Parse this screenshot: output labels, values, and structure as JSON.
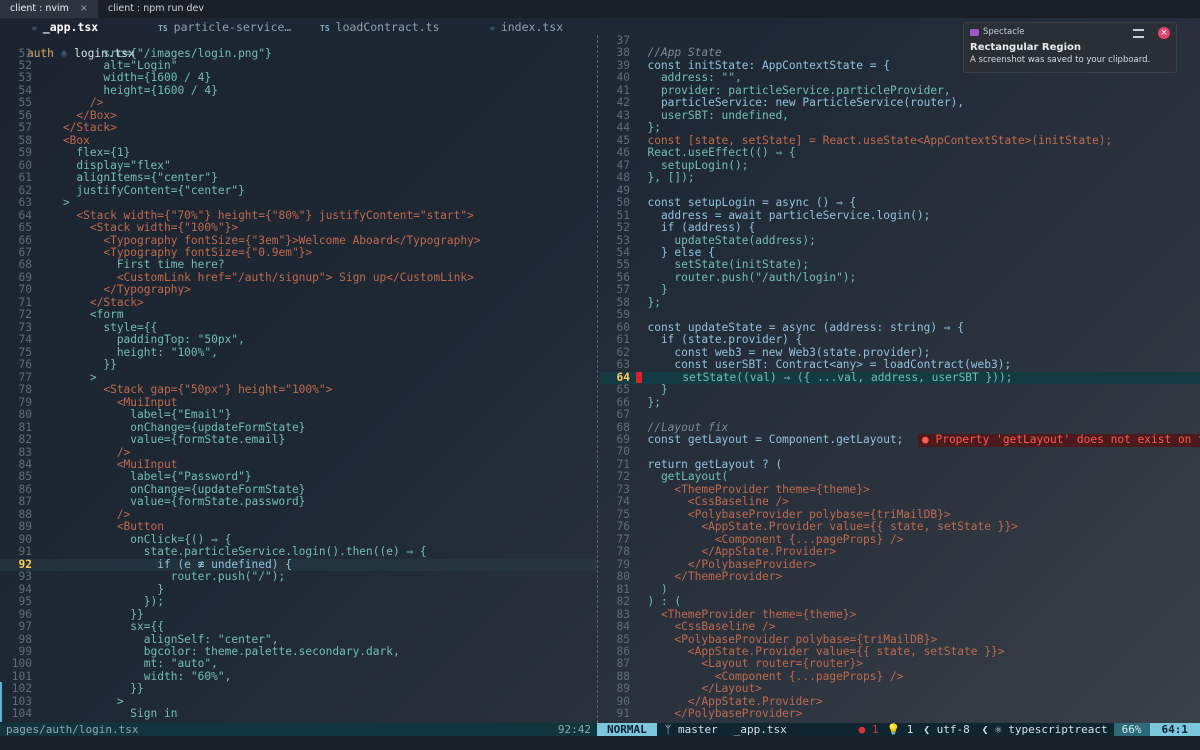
{
  "tmux": {
    "tabs": [
      {
        "label": "client : nvim",
        "active": true
      },
      {
        "label": "client : npm run dev",
        "active": false
      }
    ],
    "close_glyph": "×"
  },
  "buffers": [
    {
      "label": "_app.tsx",
      "active": true,
      "icon": "react-file-icon"
    },
    {
      "label": "particle-service…",
      "active": false,
      "icon": "typescript-file-icon",
      "icon_text": "TS"
    },
    {
      "label": "loadContract.ts",
      "active": false,
      "icon": "typescript-file-icon",
      "icon_text": "TS"
    },
    {
      "label": "index.tsx",
      "active": false,
      "icon": "react-file-icon"
    }
  ],
  "left_pane": {
    "path_prefix": "auth",
    "file_tab": "login.tsx",
    "lines": [
      {
        "n": "51",
        "t": "          src={\"/images/login.png\"}"
      },
      {
        "n": "52",
        "t": "          alt=\"Login\""
      },
      {
        "n": "53",
        "t": "          width={1600 / 4}"
      },
      {
        "n": "54",
        "t": "          height={1600 / 4}"
      },
      {
        "n": "55",
        "t": "        />"
      },
      {
        "n": "56",
        "t": "      </Box>"
      },
      {
        "n": "57",
        "t": "    </Stack>"
      },
      {
        "n": "58",
        "t": "    <Box"
      },
      {
        "n": "59",
        "t": "      flex={1}"
      },
      {
        "n": "60",
        "t": "      display=\"flex\""
      },
      {
        "n": "61",
        "t": "      alignItems={\"center\"}"
      },
      {
        "n": "62",
        "t": "      justifyContent={\"center\"}"
      },
      {
        "n": "63",
        "t": "    >"
      },
      {
        "n": "64",
        "t": "      <Stack width={\"70%\"} height={\"80%\"} justifyContent=\"start\">"
      },
      {
        "n": "65",
        "t": "        <Stack width={\"100%\"}>"
      },
      {
        "n": "66",
        "t": "          <Typography fontSize={\"3em\"}>Welcome Aboard</Typography>"
      },
      {
        "n": "67",
        "t": "          <Typography fontSize={\"0.9em\"}>"
      },
      {
        "n": "68",
        "t": "            First time here?"
      },
      {
        "n": "69",
        "t": "            <CustomLink href=\"/auth/signup\"> Sign up</CustomLink>"
      },
      {
        "n": "70",
        "t": "          </Typography>"
      },
      {
        "n": "71",
        "t": "        </Stack>"
      },
      {
        "n": "72",
        "t": "        <form"
      },
      {
        "n": "73",
        "t": "          style={{"
      },
      {
        "n": "74",
        "t": "            paddingTop: \"50px\","
      },
      {
        "n": "75",
        "t": "            height: \"100%\","
      },
      {
        "n": "76",
        "t": "          }}"
      },
      {
        "n": "77",
        "t": "        >"
      },
      {
        "n": "78",
        "t": "          <Stack gap={\"50px\"} height=\"100%\">"
      },
      {
        "n": "79",
        "t": "            <MuiInput"
      },
      {
        "n": "80",
        "t": "              label={\"Email\"}"
      },
      {
        "n": "81",
        "t": "              onChange={updateFormState}"
      },
      {
        "n": "82",
        "t": "              value={formState.email}"
      },
      {
        "n": "83",
        "t": "            />"
      },
      {
        "n": "84",
        "t": "            <MuiInput"
      },
      {
        "n": "85",
        "t": "              label={\"Password\"}"
      },
      {
        "n": "86",
        "t": "              onChange={updateFormState}"
      },
      {
        "n": "87",
        "t": "              value={formState.password}"
      },
      {
        "n": "88",
        "t": "            />"
      },
      {
        "n": "89",
        "t": "            <Button"
      },
      {
        "n": "90",
        "t": "              onClick={() ⇒ {"
      },
      {
        "n": "91",
        "t": "                state.particleService.login().then((e) ⇒ {"
      },
      {
        "n": "92",
        "t": "                  if (e ≢ undefined) {",
        "cur": true
      },
      {
        "n": "93",
        "t": "                    router.push(\"/\");"
      },
      {
        "n": "94",
        "t": "                  }"
      },
      {
        "n": "95",
        "t": "                });"
      },
      {
        "n": "96",
        "t": "              }}"
      },
      {
        "n": "97",
        "t": "              sx={{"
      },
      {
        "n": "98",
        "t": "                alignSelf: \"center\","
      },
      {
        "n": "99",
        "t": "                bgcolor: theme.palette.secondary.dark,"
      },
      {
        "n": "100",
        "t": "                mt: \"auto\","
      },
      {
        "n": "101",
        "t": "                width: \"60%\","
      },
      {
        "n": "102",
        "t": "              }}"
      },
      {
        "n": "103",
        "t": "            >"
      },
      {
        "n": "104",
        "t": "              Sign in"
      }
    ],
    "status_path": "pages/auth/login.tsx",
    "status_pos": "92:42"
  },
  "right_pane": {
    "lines": [
      {
        "n": "37",
        "t": ""
      },
      {
        "n": "38",
        "t": "  //App State",
        "k": "comment"
      },
      {
        "n": "39",
        "t": "  const initState: AppContextState = {"
      },
      {
        "n": "40",
        "t": "    address: \"\","
      },
      {
        "n": "41",
        "t": "    provider: particleService.particleProvider,"
      },
      {
        "n": "42",
        "t": "    particleService: new ParticleService(router),"
      },
      {
        "n": "43",
        "t": "    userSBT: undefined,"
      },
      {
        "n": "44",
        "t": "  };"
      },
      {
        "n": "45",
        "t": "  const [state, setState] = React.useState<AppContextState>(initState);"
      },
      {
        "n": "46",
        "t": "  React.useEffect(() ⇒ {"
      },
      {
        "n": "47",
        "t": "    setupLogin();"
      },
      {
        "n": "48",
        "t": "  }, []);"
      },
      {
        "n": "49",
        "t": ""
      },
      {
        "n": "50",
        "t": "  const setupLogin = async () ⇒ {"
      },
      {
        "n": "51",
        "t": "    address = await particleService.login();"
      },
      {
        "n": "52",
        "t": "    if (address) {"
      },
      {
        "n": "53",
        "t": "      updateState(address);"
      },
      {
        "n": "54",
        "t": "    } else {"
      },
      {
        "n": "55",
        "t": "      setState(initState);"
      },
      {
        "n": "56",
        "t": "      router.push(\"/auth/login\");"
      },
      {
        "n": "57",
        "t": "    }"
      },
      {
        "n": "58",
        "t": "  };"
      },
      {
        "n": "59",
        "t": ""
      },
      {
        "n": "60",
        "t": "  const updateState = async (address: string) ⇒ {"
      },
      {
        "n": "61",
        "t": "    if (state.provider) {"
      },
      {
        "n": "62",
        "t": "      const web3 = new Web3(state.provider);"
      },
      {
        "n": "63",
        "t": "      const userSBT: Contract<any> = loadContract(web3);"
      },
      {
        "n": "64",
        "t": "      setState((val) ⇒ ({ ...val, address, userSBT }));",
        "cur": true
      },
      {
        "n": "65",
        "t": "    }"
      },
      {
        "n": "66",
        "t": "  };"
      },
      {
        "n": "67",
        "t": ""
      },
      {
        "n": "68",
        "t": "  //Layout fix",
        "k": "comment"
      },
      {
        "n": "69",
        "t": "  const getLayout = Component.getLayout;",
        "err": true
      },
      {
        "n": "70",
        "t": ""
      },
      {
        "n": "71",
        "t": "  return getLayout ? ("
      },
      {
        "n": "72",
        "t": "    getLayout("
      },
      {
        "n": "73",
        "t": "      <ThemeProvider theme={theme}>"
      },
      {
        "n": "74",
        "t": "        <CssBaseline />"
      },
      {
        "n": "75",
        "t": "        <PolybaseProvider polybase={triMailDB}>"
      },
      {
        "n": "76",
        "t": "          <AppState.Provider value={{ state, setState }}>"
      },
      {
        "n": "77",
        "t": "            <Component {...pageProps} />"
      },
      {
        "n": "78",
        "t": "          </AppState.Provider>"
      },
      {
        "n": "79",
        "t": "        </PolybaseProvider>"
      },
      {
        "n": "80",
        "t": "      </ThemeProvider>"
      },
      {
        "n": "81",
        "t": "    )"
      },
      {
        "n": "82",
        "t": "  ) : ("
      },
      {
        "n": "83",
        "t": "    <ThemeProvider theme={theme}>"
      },
      {
        "n": "84",
        "t": "      <CssBaseline />"
      },
      {
        "n": "85",
        "t": "      <PolybaseProvider polybase={triMailDB}>"
      },
      {
        "n": "86",
        "t": "        <AppState.Provider value={{ state, setState }}>"
      },
      {
        "n": "87",
        "t": "          <Layout router={router}>"
      },
      {
        "n": "88",
        "t": "            <Component {...pageProps} />"
      },
      {
        "n": "89",
        "t": "          </Layout>"
      },
      {
        "n": "90",
        "t": "        </AppState.Provider>"
      },
      {
        "n": "91",
        "t": "      </PolybaseProvider>"
      }
    ],
    "diagnostic": "● Property 'getLayout' does not exist on ty"
  },
  "statusline": {
    "mode": "NORMAL",
    "branch": "master",
    "file": "_app.tsx",
    "errors": "● 1",
    "hints": "1",
    "encoding": "utf-8",
    "filetype": "typescriptreact",
    "percent": "66%",
    "linecol": "64:1"
  },
  "notification": {
    "app": "Spectacle",
    "title": "Rectangular Region",
    "body": "A screenshot was saved to your clipboard."
  },
  "colors": {
    "error": "#e0202a",
    "mode_bg": "#7bc5dd",
    "cursor_line_bg": "#143a44"
  }
}
